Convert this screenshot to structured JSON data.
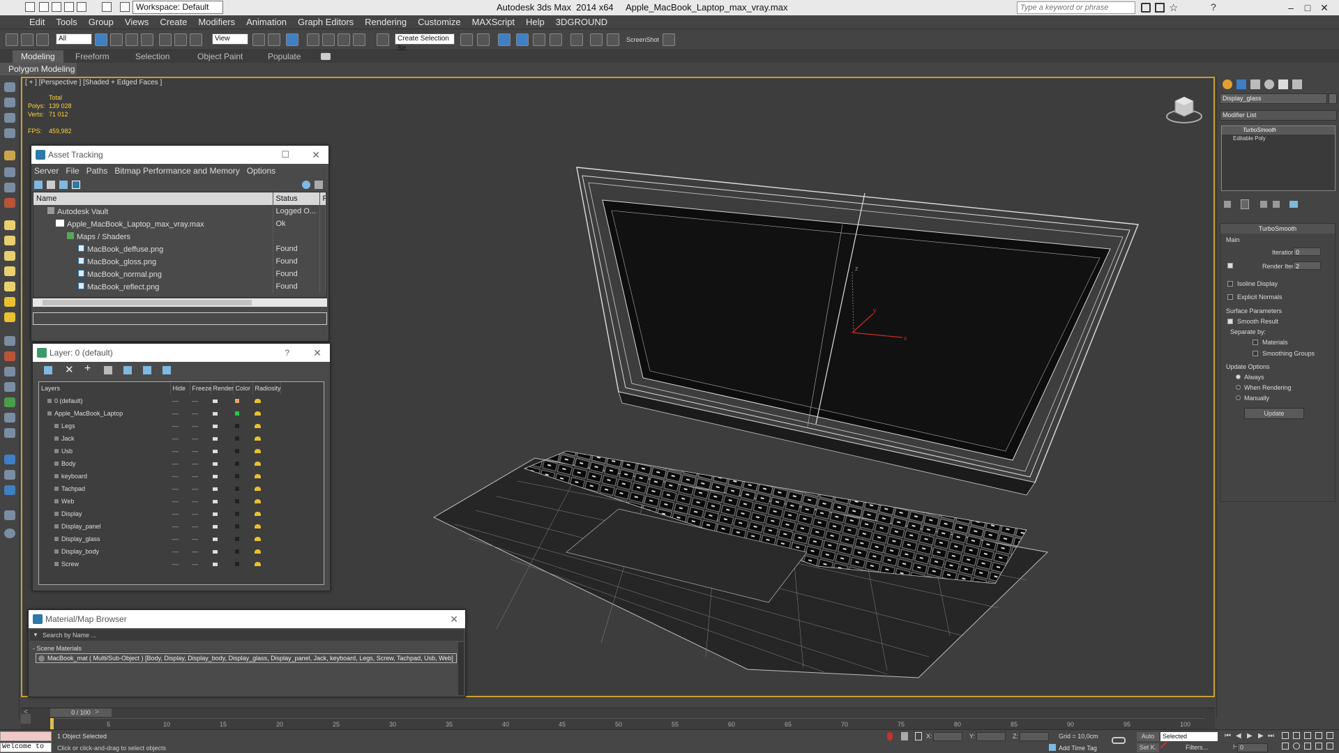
{
  "app": {
    "title": "Autodesk 3ds Max  2014 x64     Apple_MacBook_Laptop_max_vray.max",
    "workspace": "Workspace: Default",
    "search_placeholder": "Type a keyword or phrase"
  },
  "menu": [
    "Edit",
    "Tools",
    "Group",
    "Views",
    "Create",
    "Modifiers",
    "Animation",
    "Graph Editors",
    "Rendering",
    "Customize",
    "MAXScript",
    "Help",
    "3DGROUND"
  ],
  "toolbar": {
    "filter_value": "All",
    "view_value": "View",
    "selection_set_placeholder": "Create Selection Se",
    "screenshot_label": "ScreenShot"
  },
  "ribbon": {
    "tabs": [
      "Modeling",
      "Freeform",
      "Selection",
      "Object Paint",
      "Populate"
    ],
    "active_tab": "Modeling",
    "panel_label": "Polygon Modeling"
  },
  "viewport": {
    "label": "[ + ] [Perspective ] [Shaded + Edged Faces ]",
    "stats": {
      "total_label": "Total",
      "polys_label": "Polys:",
      "polys_value": "139 028",
      "verts_label": "Verts:",
      "verts_value": "71 012",
      "fps_label": "FPS:",
      "fps_value": "459,982"
    },
    "gizmo_labels": {
      "x": "x",
      "y": "y",
      "z": "z"
    }
  },
  "asset_tracking": {
    "title": "Asset Tracking",
    "menus": [
      "Server",
      "File",
      "Paths",
      "Bitmap Performance and Memory",
      "Options"
    ],
    "columns": [
      "Name",
      "Status",
      "P"
    ],
    "rows": [
      {
        "name": "Autodesk Vault",
        "status": "Logged O..."
      },
      {
        "name": "Apple_MacBook_Laptop_max_vray.max",
        "status": "Ok"
      },
      {
        "name": "Maps / Shaders",
        "status": ""
      },
      {
        "name": "MacBook_deffuse.png",
        "status": "Found"
      },
      {
        "name": "MacBook_gloss.png",
        "status": "Found"
      },
      {
        "name": "MacBook_normal.png",
        "status": "Found"
      },
      {
        "name": "MacBook_reflect.png",
        "status": "Found"
      }
    ]
  },
  "layer_window": {
    "title": "Layer: 0 (default)",
    "help": "?",
    "columns": [
      "Layers",
      "Hide",
      "Freeze",
      "Render",
      "Color",
      "Radiosity"
    ],
    "layers": [
      {
        "name": "0 (default)",
        "color": "#e8a070"
      },
      {
        "name": "Apple_MacBook_Laptop",
        "color": "#22cc44"
      },
      {
        "name": "Legs",
        "color": "#222222"
      },
      {
        "name": "Jack",
        "color": "#222222"
      },
      {
        "name": "Usb",
        "color": "#222222"
      },
      {
        "name": "Body",
        "color": "#222222"
      },
      {
        "name": "keyboard",
        "color": "#222222"
      },
      {
        "name": "Tachpad",
        "color": "#222222"
      },
      {
        "name": "Web",
        "color": "#222222"
      },
      {
        "name": "Display",
        "color": "#222222"
      },
      {
        "name": "Display_panel",
        "color": "#222222"
      },
      {
        "name": "Display_glass",
        "color": "#222222"
      },
      {
        "name": "Display_body",
        "color": "#222222"
      },
      {
        "name": "Screw",
        "color": "#222222"
      }
    ]
  },
  "material_browser": {
    "title": "Material/Map Browser",
    "search_placeholder": "Search by Name ...",
    "section": "- Scene Materials",
    "material": "MacBook_mat ( Multi/Sub-Object ) [Body, Display, Display_body, Display_glass, Display_panel, Jack, keyboard, Legs, Screw, Tachpad, Usb, Web]"
  },
  "command_panel": {
    "object_name": "Display_glass",
    "modifier_list": "Modifier List",
    "stack": [
      "TurboSmooth",
      "Editable Poly"
    ],
    "rollout_title": "TurboSmooth",
    "main_label": "Main",
    "iterations_label": "Iterations:",
    "iterations_value": "0",
    "render_iters_label": "Render Iters:",
    "render_iters_value": "2",
    "isoline": "Isoline Display",
    "explicit_normals": "Explicit Normals",
    "surface_params": "Surface Parameters",
    "smooth_result": "Smooth Result",
    "separate_by": "Separate by:",
    "materials": "Materials",
    "smoothing_groups": "Smoothing Groups",
    "update_options": "Update Options",
    "always": "Always",
    "when_rendering": "When Rendering",
    "manually": "Manually",
    "update_button": "Update"
  },
  "timeline": {
    "frame_counter": "0 / 100",
    "ticks": [
      "0",
      "5",
      "10",
      "15",
      "20",
      "25",
      "30",
      "35",
      "40",
      "45",
      "50",
      "55",
      "60",
      "65",
      "70",
      "75",
      "80",
      "85",
      "90",
      "95",
      "100"
    ]
  },
  "status": {
    "maxscript": "Welcome to",
    "selected": "1 Object Selected",
    "prompt": "Click or click-and-drag to select objects",
    "x_label": "X:",
    "y_label": "Y:",
    "z_label": "Z:",
    "grid": "Grid = 10,0cm",
    "auto": "Auto",
    "selected_dropdown": "Selected",
    "set_key": "Set K.",
    "filters": "Filters...",
    "add_time_tag": "Add Time Tag",
    "frame": "0"
  }
}
